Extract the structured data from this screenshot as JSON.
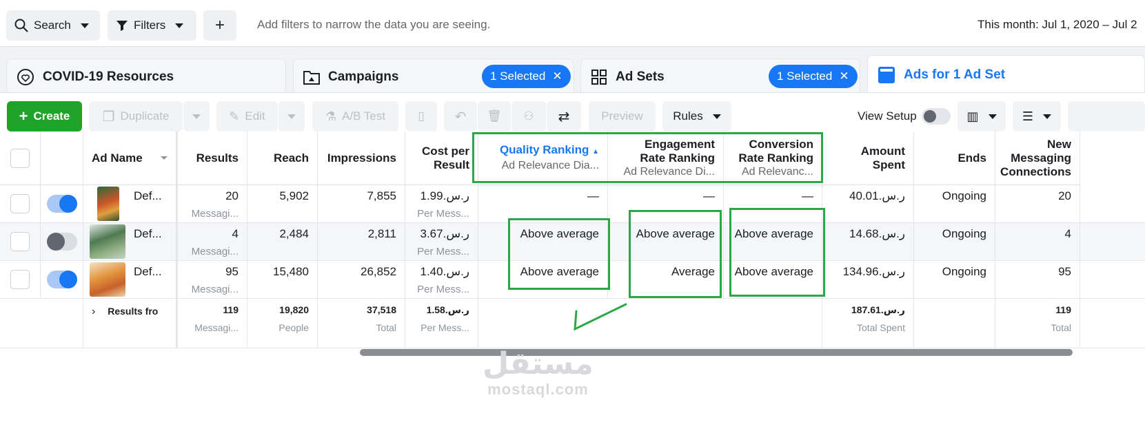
{
  "topbar": {
    "search_label": "Search",
    "filters_label": "Filters",
    "add_label": "+",
    "hint": "Add filters to narrow the data you are seeing.",
    "date_range": "This month: Jul 1, 2020 – Jul 2"
  },
  "tabs": [
    {
      "label": "COVID-19 Resources"
    },
    {
      "label": "Campaigns",
      "badge": "1 Selected"
    },
    {
      "label": "Ad Sets",
      "badge": "1 Selected"
    },
    {
      "label": "Ads for 1 Ad Set"
    }
  ],
  "toolbar": {
    "create": "Create",
    "duplicate": "Duplicate",
    "edit": "Edit",
    "ab_test": "A/B Test",
    "preview": "Preview",
    "rules": "Rules",
    "view_setup": "View Setup"
  },
  "columns": {
    "ad_name": "Ad Name",
    "results": "Results",
    "reach": "Reach",
    "impressions": "Impressions",
    "cost_per_result_1": "Cost per",
    "cost_per_result_2": "Result",
    "quality_ranking": "Quality Ranking",
    "quality_sub": "Ad Relevance Dia...",
    "engagement_1": "Engagement",
    "engagement_2": "Rate Ranking",
    "engagement_sub": "Ad Relevance Di...",
    "conversion_1": "Conversion",
    "conversion_2": "Rate Ranking",
    "conversion_sub": "Ad Relevanc...",
    "amount_1": "Amount",
    "amount_2": "Spent",
    "ends": "Ends",
    "new_msg_1": "New",
    "new_msg_2": "Messaging",
    "new_msg_3": "Connections"
  },
  "rows": [
    {
      "name": "Def...",
      "results": "20",
      "results_sub": "Messagi...",
      "reach": "5,902",
      "impressions": "7,855",
      "cost": "1.99.ر.س",
      "cost_sub": "Per Mess...",
      "quality": "—",
      "engagement": "—",
      "conversion": "—",
      "amount": "40.01.ر.س",
      "ends": "Ongoing",
      "new_msg": "20"
    },
    {
      "name": "Def...",
      "results": "4",
      "results_sub": "Messagi...",
      "reach": "2,484",
      "impressions": "2,811",
      "cost": "3.67.ر.س",
      "cost_sub": "Per Mess...",
      "quality": "Above average",
      "engagement": "Above average",
      "conversion": "Above average",
      "amount": "14.68.ر.س",
      "ends": "Ongoing",
      "new_msg": "4"
    },
    {
      "name": "Def...",
      "results": "95",
      "results_sub": "Messagi...",
      "reach": "15,480",
      "impressions": "26,852",
      "cost": "1.40.ر.س",
      "cost_sub": "Per Mess...",
      "quality": "Above average",
      "engagement": "Average",
      "conversion": "Above average",
      "amount": "134.96.ر.س",
      "ends": "Ongoing",
      "new_msg": "95"
    }
  ],
  "totals": {
    "label": "Results fro",
    "results": "119",
    "results_sub": "Messagi...",
    "reach": "19,820",
    "reach_sub": "People",
    "impressions": "37,518",
    "impressions_sub": "Total",
    "cost": "1.58.ر.س",
    "cost_sub": "Per Mess...",
    "amount": "187.61.ر.س",
    "amount_sub": "Total Spent",
    "new_msg": "119",
    "new_msg_sub": "Total"
  },
  "watermark": {
    "arabic": "مستقل",
    "latin": "mostaql.com"
  },
  "colors": {
    "accent": "#1877f2",
    "create": "#1fa329",
    "highlight": "#2aa845"
  }
}
